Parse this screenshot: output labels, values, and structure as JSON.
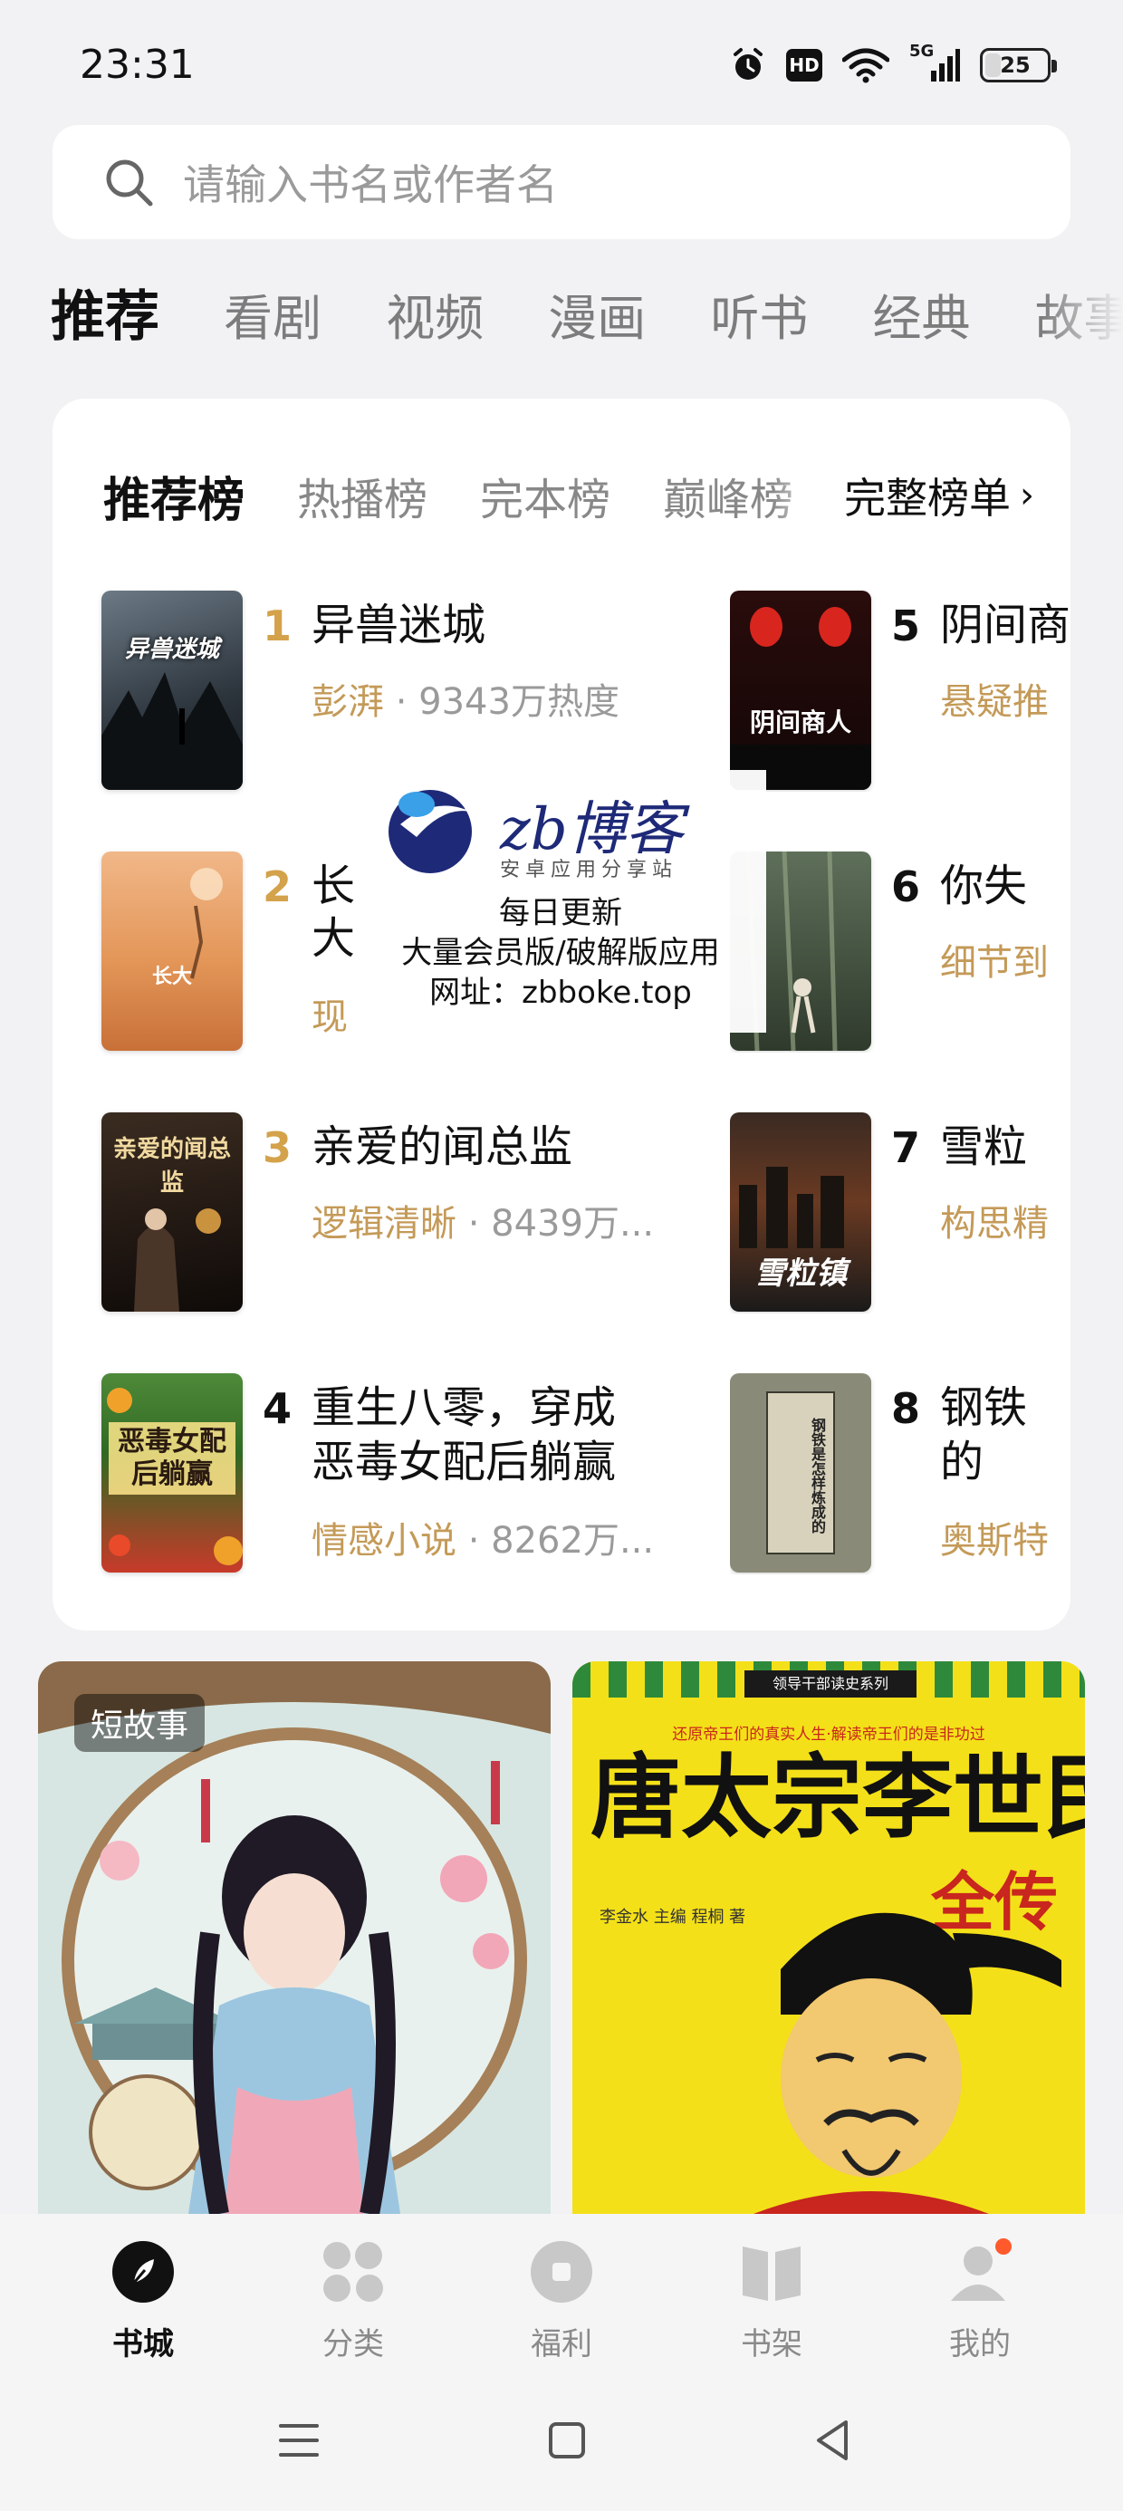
{
  "status_bar": {
    "time": "23:31",
    "hd": "HD",
    "network": "5G",
    "battery": "25",
    "battery_level": 0.25
  },
  "search": {
    "placeholder": "请输入书名或作者名"
  },
  "category_tabs": [
    {
      "label": "推荐",
      "active": true
    },
    {
      "label": "看剧",
      "active": false
    },
    {
      "label": "视频",
      "active": false
    },
    {
      "label": "漫画",
      "active": false
    },
    {
      "label": "听书",
      "active": false
    },
    {
      "label": "经典",
      "active": false
    },
    {
      "label": "故事",
      "active": false
    }
  ],
  "ranking": {
    "tabs": [
      {
        "label": "推荐榜",
        "active": true
      },
      {
        "label": "热播榜",
        "active": false
      },
      {
        "label": "完本榜",
        "active": false
      },
      {
        "label": "巅峰榜",
        "active": false
      }
    ],
    "full_list_label": "完整榜单",
    "books": [
      {
        "rank": "1",
        "title": "异兽迷城",
        "title2": "",
        "author": "彭湃",
        "heat": "9343万热度",
        "cover_text": "异兽迷城",
        "rank_color": "#d4a24a"
      },
      {
        "rank": "2",
        "title": "长",
        "title2": "大",
        "author": "现",
        "heat": "",
        "cover_text": "长大",
        "rank_color": "#d4a24a"
      },
      {
        "rank": "3",
        "title": "亲爱的闻总监",
        "title2": "",
        "author": "逻辑清晰",
        "heat": "8439万...",
        "cover_text": "亲爱的闻总监",
        "rank_color": "#d4a24a"
      },
      {
        "rank": "4",
        "title": "重生八零，穿成",
        "title2": "恶毒女配后躺赢",
        "author": "情感小说",
        "heat": "8262万...",
        "cover_text": "恶毒女配后躺赢",
        "rank_color": "#111111"
      },
      {
        "rank": "5",
        "title": "阴间商",
        "title2": "",
        "author": "悬疑推",
        "heat": "",
        "cover_text": "阴间商人",
        "rank_color": "#111111"
      },
      {
        "rank": "6",
        "title": "你失",
        "title2": "",
        "author": "细节到",
        "heat": "",
        "cover_text": "",
        "rank_color": "#111111"
      },
      {
        "rank": "7",
        "title": "雪粒",
        "title2": "",
        "author": "构思精",
        "heat": "",
        "cover_text": "雪粒镇",
        "rank_color": "#111111"
      },
      {
        "rank": "8",
        "title": "钢铁",
        "title2": "的",
        "author": "奥斯特",
        "heat": "",
        "cover_text": "钢铁是怎样炼成的",
        "rank_color": "#111111"
      }
    ]
  },
  "watermark": {
    "brand": "zb博客",
    "sub": "安卓应用分享站",
    "line1": "每日更新",
    "line2": "大量会员版/破解版应用",
    "line3": "网址：zbboke.top"
  },
  "promos": [
    {
      "badge": "短故事"
    },
    {
      "series": "领导干部读史系列",
      "slogan": "还原帝王们的真实人生·解读帝王们的是非功过",
      "title_main": "唐太宗李世民",
      "title_sub": "全传",
      "credits": "李金水 主编   程桐 著"
    }
  ],
  "bottom_nav": [
    {
      "label": "书城",
      "icon": "bookstore-icon",
      "active": true
    },
    {
      "label": "分类",
      "icon": "category-icon",
      "active": false
    },
    {
      "label": "福利",
      "icon": "welfare-icon",
      "active": false
    },
    {
      "label": "书架",
      "icon": "bookshelf-icon",
      "active": false
    },
    {
      "label": "我的",
      "icon": "profile-icon",
      "active": false,
      "badge": true
    }
  ],
  "colors": {
    "accent_gold": "#c49a58",
    "badge_red": "#ff5a2c",
    "bg": "#f2f2f4"
  }
}
